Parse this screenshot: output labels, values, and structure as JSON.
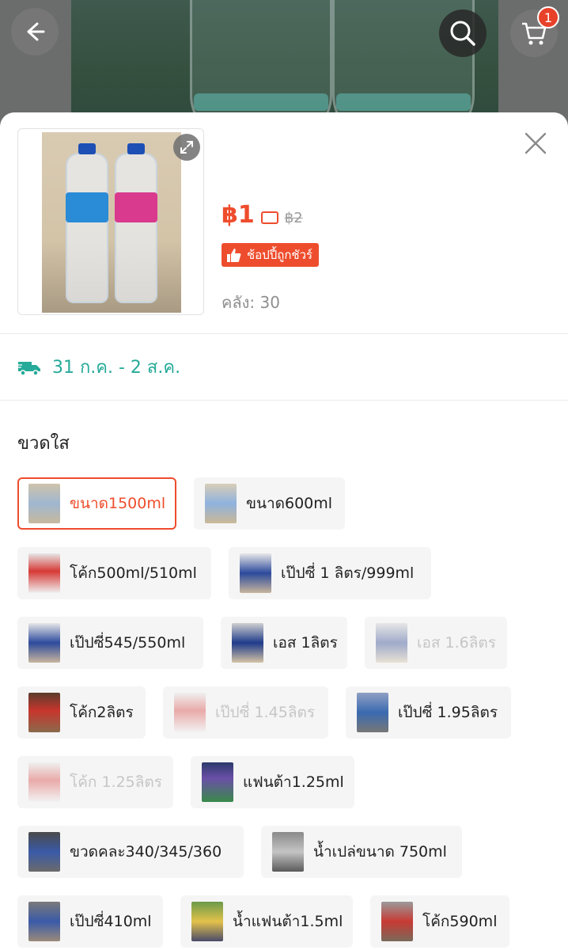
{
  "header": {
    "cart_count": "1"
  },
  "product": {
    "currency": "฿",
    "price": "฿1",
    "original_price": "฿2",
    "badge_label": "ช้อปปี้ถูกชัวร์",
    "stock_label": "คลัง: 30"
  },
  "shipping": {
    "date_range": "31 ก.ค. - 2 ส.ค."
  },
  "variation": {
    "title": "ขวดใส",
    "options": [
      {
        "label": "ขนาด1500ml",
        "state": "selected",
        "thumb": "nestle-bottles"
      },
      {
        "label": "ขนาด600ml",
        "state": "normal",
        "thumb": "water-bottles"
      },
      {
        "label": "โค้ก500ml/510ml",
        "state": "normal",
        "thumb": "coke-bottles"
      },
      {
        "label": "เป๊ปซี่ 1 ลิตร/999ml",
        "state": "normal",
        "thumb": "pepsi-bottles"
      },
      {
        "label": "เป๊ปซี่545/550ml",
        "state": "normal",
        "thumb": "pepsi-bottles"
      },
      {
        "label": "เอส 1ลิตร",
        "state": "normal",
        "thumb": "est-bottles"
      },
      {
        "label": "เอส 1.6ลิตร",
        "state": "disabled",
        "thumb": "est-bottles"
      },
      {
        "label": "โค้ก2ลิตร",
        "state": "normal",
        "thumb": "coke-bottles"
      },
      {
        "label": "เป๊ปซี่ 1.45ลิตร",
        "state": "disabled",
        "thumb": "pepsi-bottles"
      },
      {
        "label": "เป๊ปซี่ 1.95ลิตร",
        "state": "normal",
        "thumb": "mixed-bottles"
      },
      {
        "label": "โค้ก 1.25ลิตร",
        "state": "disabled",
        "thumb": "coke-bottles"
      },
      {
        "label": "แฟนต้า1.25ml",
        "state": "normal",
        "thumb": "fanta-bottles"
      },
      {
        "label": "ขวดคละ340/345/360",
        "state": "normal",
        "thumb": "mixed-bottles"
      },
      {
        "label": "น้ำเปล่ขนาด 750ml",
        "state": "normal",
        "thumb": "hand-bottle"
      },
      {
        "label": "เป๊ปซี่410ml",
        "state": "normal",
        "thumb": "pepsi-bottles"
      },
      {
        "label": "น้ำแฟนต้า1.5ml",
        "state": "normal",
        "thumb": "fanta-bottles"
      },
      {
        "label": "โค้ก590ml",
        "state": "normal",
        "thumb": "coke-bottles"
      }
    ]
  },
  "colors": {
    "accent": "#ee4d2d",
    "shipping": "#26aa99"
  }
}
